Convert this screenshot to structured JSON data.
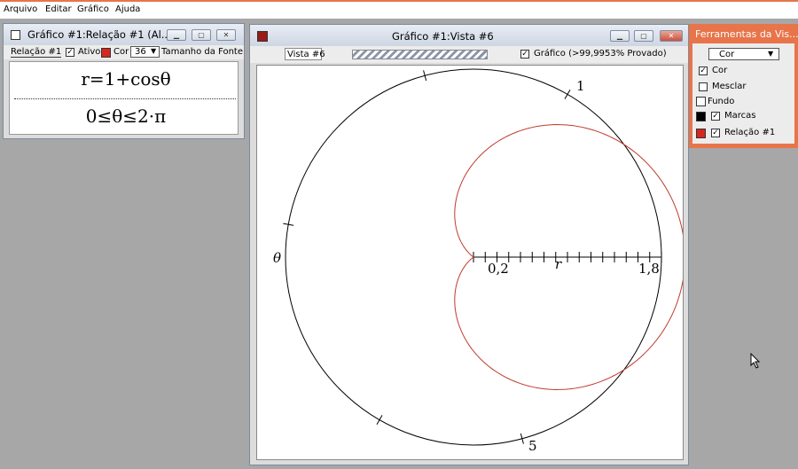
{
  "menu": {
    "items": [
      "Arquivo",
      "Editar",
      "Gráfico",
      "Ajuda"
    ]
  },
  "relation_window": {
    "title": "Gráfico #1:Relação #1 (Al...",
    "tab": "Relação #1",
    "ativo_label": "Ativo",
    "ativo_checked": true,
    "cor_label": "Cor",
    "cor_color": "#d7261e",
    "font_size": "36",
    "font_label": "Tamanho da Fonte",
    "formula": "r=1+cosθ",
    "domain": "0≤θ≤2·π"
  },
  "graph_window": {
    "title": "Gráfico #1:Vista #6",
    "view_field": "Vista #6",
    "grafico_label": "Gráfico (>99,9953% Provado)",
    "grafico_checked": true,
    "axis_labels": {
      "r": "r",
      "theta": "θ",
      "r_min": "0,2",
      "r_max": "1,8",
      "circle_top": "1",
      "circle_bottom": "5"
    }
  },
  "tools_panel": {
    "title": "Ferramentas da Vis...",
    "dropdown": "Cor",
    "items": [
      {
        "label": "Cor",
        "checked": true,
        "swatch": null
      },
      {
        "label": "Mesclar",
        "checked": false,
        "swatch": null
      },
      {
        "label": "Fundo",
        "checked": false,
        "swatch": "#ffffff"
      },
      {
        "label": "Marcas",
        "checked": true,
        "swatch": "#000000"
      },
      {
        "label": "Relação #1",
        "checked": true,
        "swatch": "#d7261e"
      }
    ],
    "accent": "#e8744a"
  },
  "chart_data": {
    "type": "line",
    "equation": "r=1+cosθ",
    "theta_range": [
      "0",
      "2·π"
    ],
    "r_range": [
      0.2,
      1.8
    ],
    "polar": true,
    "series": [
      {
        "color": "#c0392b"
      }
    ]
  }
}
